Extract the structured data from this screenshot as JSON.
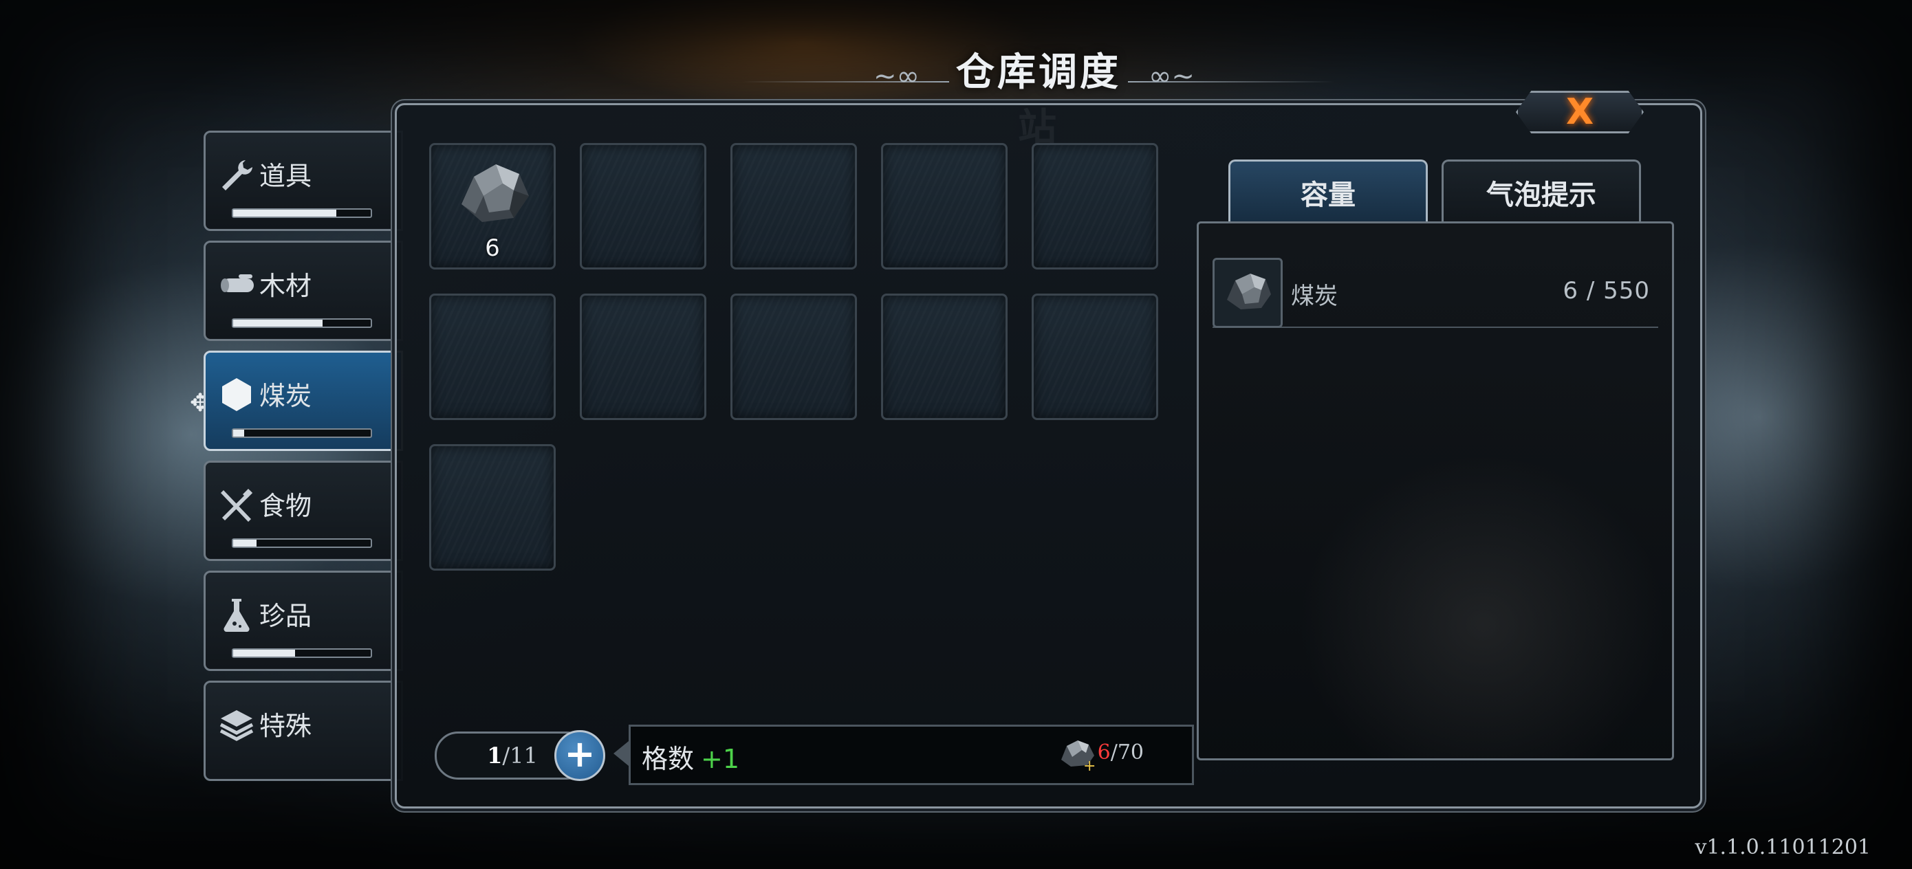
{
  "title": "仓库调度站",
  "close_label": "X",
  "categories": [
    {
      "label": "道具",
      "icon": "wrench-icon",
      "fill": 0.75
    },
    {
      "label": "木材",
      "icon": "log-icon",
      "fill": 0.65
    },
    {
      "label": "煤炭",
      "icon": "hexagon-icon",
      "fill": 0.08,
      "active": true
    },
    {
      "label": "食物",
      "icon": "fork-knife-icon",
      "fill": 0.17
    },
    {
      "label": "珍品",
      "icon": "flask-icon",
      "fill": 0.45
    },
    {
      "label": "特殊",
      "icon": "layers-icon",
      "fill": 0
    }
  ],
  "grid": {
    "total_slots": 11,
    "items": [
      {
        "name": "煤炭",
        "count": "6",
        "icon": "coal-icon"
      }
    ]
  },
  "pager": {
    "current": "1",
    "total": "/11"
  },
  "expand_tip": {
    "label": "格数",
    "bonus": "+1",
    "have": "6",
    "need": "/70"
  },
  "tabs": {
    "capacity": "容量",
    "bubble": "气泡提示"
  },
  "capacity_list": [
    {
      "name": "煤炭",
      "value": "6 / 550",
      "icon": "coal-icon"
    }
  ],
  "version": "v1.1.0.11011201"
}
